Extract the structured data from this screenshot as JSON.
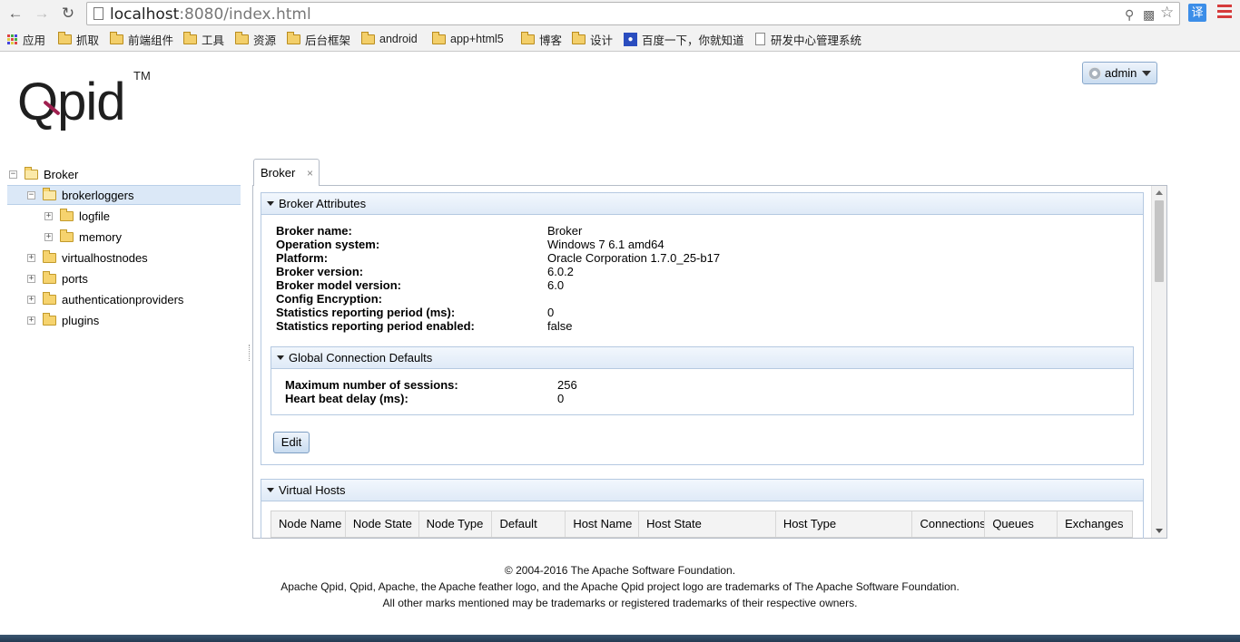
{
  "browser": {
    "url_host": "localhost",
    "url_rest": ":8080/index.html",
    "ext_label": "译",
    "bookmarks": [
      {
        "label": "应用",
        "type": "apps"
      },
      {
        "label": "抓取",
        "type": "folder"
      },
      {
        "label": "前端组件",
        "type": "folder"
      },
      {
        "label": "工具",
        "type": "folder"
      },
      {
        "label": "资源",
        "type": "folder"
      },
      {
        "label": "后台框架",
        "type": "folder"
      },
      {
        "label": "android",
        "type": "folder"
      },
      {
        "label": "app+html5",
        "type": "folder"
      },
      {
        "label": "博客",
        "type": "folder"
      },
      {
        "label": "设计",
        "type": "folder"
      },
      {
        "label": "百度一下，你就知道",
        "type": "baidu"
      },
      {
        "label": "研发中心管理系统",
        "type": "page"
      }
    ]
  },
  "header": {
    "logo_text": "Qpid",
    "logo_tm": "TM",
    "user_label": "admin"
  },
  "tree": {
    "root": "Broker",
    "brokerloggers": "brokerloggers",
    "logfile": "logfile",
    "memory": "memory",
    "virtualhostnodes": "virtualhostnodes",
    "ports": "ports",
    "authenticationproviders": "authenticationproviders",
    "plugins": "plugins"
  },
  "tab": {
    "label": "Broker",
    "close": "×"
  },
  "broker_attributes": {
    "title": "Broker Attributes",
    "rows": [
      {
        "label": "Broker name:",
        "value": "Broker"
      },
      {
        "label": "Operation system:",
        "value": "Windows 7 6.1 amd64"
      },
      {
        "label": "Platform:",
        "value": "Oracle Corporation 1.7.0_25-b17"
      },
      {
        "label": "Broker version:",
        "value": "6.0.2"
      },
      {
        "label": "Broker model version:",
        "value": "6.0"
      },
      {
        "label": "Config Encryption:",
        "value": ""
      },
      {
        "label": "Statistics reporting period (ms):",
        "value": "0"
      },
      {
        "label": "Statistics reporting period enabled:",
        "value": "false"
      }
    ],
    "global_defaults": {
      "title": "Global Connection Defaults",
      "rows": [
        {
          "label": "Maximum number of sessions:",
          "value": "256"
        },
        {
          "label": "Heart beat delay (ms):",
          "value": "0"
        }
      ]
    },
    "edit_label": "Edit"
  },
  "virtual_hosts": {
    "title": "Virtual Hosts",
    "columns": [
      "Node Name",
      "Node State",
      "Node Type",
      "Default",
      "Host Name",
      "Host State",
      "Host Type",
      "Connections",
      "Queues",
      "Exchanges"
    ]
  },
  "footer": {
    "line1": "© 2004-2016 The Apache Software Foundation.",
    "line2": "Apache Qpid, Qpid, Apache, the Apache feather logo, and the Apache Qpid project logo are trademarks of The Apache Software Foundation.",
    "line3": "All other marks mentioned may be trademarks or registered trademarks of their respective owners."
  }
}
